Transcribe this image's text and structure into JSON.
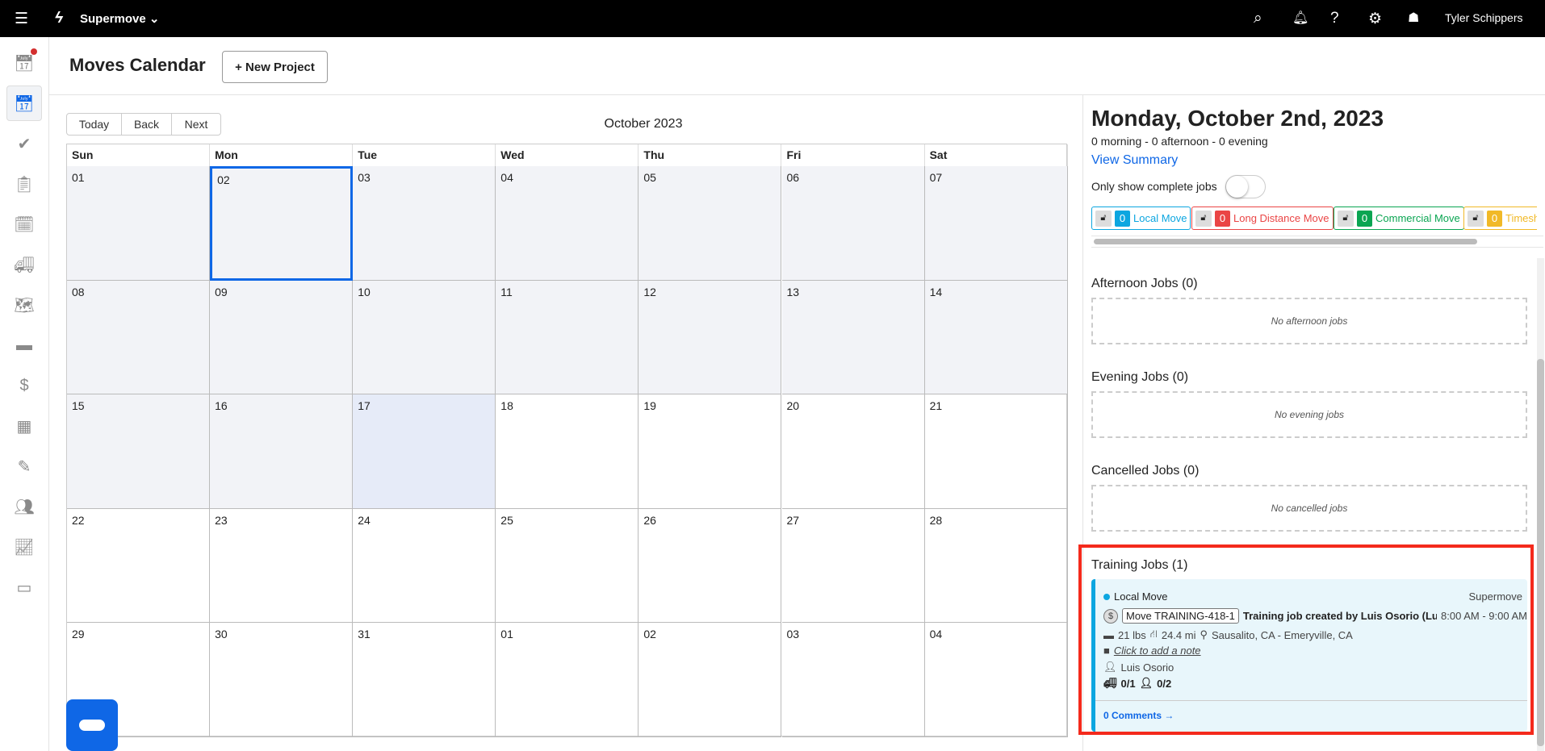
{
  "topbar": {
    "org": "Supermove",
    "user": "Tyler Schippers",
    "icons": [
      "menu-icon",
      "bolt-logo-icon",
      "search-icon",
      "bell-icon",
      "help-icon",
      "gear-icon",
      "ghost-icon"
    ]
  },
  "sidebar": {
    "icons": [
      "calendar-check-icon",
      "calendar-check-active-icon",
      "check-circle-icon",
      "clipboard-icon",
      "calendar-clock-icon",
      "truck-icon",
      "map-icon",
      "box-icon",
      "dollar-icon",
      "calculator-icon",
      "money-edit-icon",
      "users-icon",
      "chart-line-icon",
      "credit-card-icon"
    ]
  },
  "header": {
    "title": "Moves Calendar",
    "new_project": "+ New Project"
  },
  "calendar": {
    "today": "Today",
    "back": "Back",
    "next": "Next",
    "month": "October 2023",
    "days": [
      "Sun",
      "Mon",
      "Tue",
      "Wed",
      "Thu",
      "Fri",
      "Sat"
    ],
    "weeks": [
      [
        "01",
        "02",
        "03",
        "04",
        "05",
        "06",
        "07"
      ],
      [
        "08",
        "09",
        "10",
        "11",
        "12",
        "13",
        "14"
      ],
      [
        "15",
        "16",
        "17",
        "18",
        "19",
        "20",
        "21"
      ],
      [
        "22",
        "23",
        "24",
        "25",
        "26",
        "27",
        "28"
      ],
      [
        "29",
        "30",
        "31",
        "01",
        "02",
        "03",
        "04"
      ]
    ],
    "selected": "02",
    "today_date": "17"
  },
  "panel": {
    "date": "Monday, October 2nd, 2023",
    "counts": "0 morning - 0 afternoon - 0 evening",
    "view_summary": "View Summary",
    "toggle_label": "Only show complete jobs",
    "toggle_on": false,
    "filters": [
      {
        "count": "0",
        "label": "Local Move",
        "color": "#0ca6e0"
      },
      {
        "count": "0",
        "label": "Long Distance Move",
        "color": "#ea4545"
      },
      {
        "count": "0",
        "label": "Commercial Move",
        "color": "#0aa552"
      },
      {
        "count": "0",
        "label": "Timesheet",
        "color": "#f1b927"
      }
    ],
    "afternoon": "Afternoon Jobs (0)",
    "afternoon_empty": "No afternoon jobs",
    "evening": "Evening Jobs (0)",
    "evening_empty": "No evening jobs",
    "cancelled": "Cancelled Jobs (0)",
    "cancelled_empty": "No cancelled jobs",
    "training": "Training Jobs (1)",
    "job": {
      "type": "Local Move",
      "company": "Supermove",
      "id": "Move TRAINING-418-1",
      "title": "Training job created by Luis Osorio (Luis Oso…",
      "time": "8:00 AM - 9:00 AM",
      "weight": "21 lbs",
      "distance": "24.4 mi",
      "route": "Sausalito, CA - Emeryville, CA",
      "note": "Click to add a note",
      "coordinator": "Luis Osorio",
      "trucks": "0/1",
      "movers": "0/2",
      "comments": "0 Comments →"
    }
  }
}
